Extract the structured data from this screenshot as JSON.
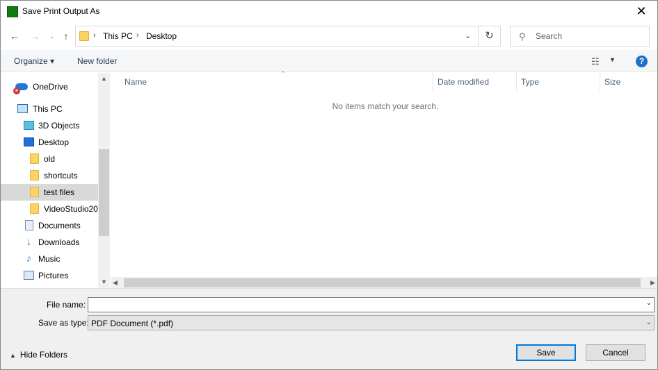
{
  "window": {
    "title": "Save Print Output As",
    "close_glyph": "✕"
  },
  "nav": {
    "back_glyph": "←",
    "forward_glyph": "→",
    "recent_glyph": "⌄",
    "up_glyph": "↑",
    "breadcrumbs": [
      "This PC",
      "Desktop"
    ],
    "separator": "›",
    "dropdown_glyph": "⌄",
    "refresh_glyph": "↻",
    "search_placeholder": "Search",
    "search_glyph": "⚲"
  },
  "toolbar": {
    "organize": "Organize ▾",
    "new_folder": "New folder",
    "view_glyph": "☷",
    "view_arrow": "▼",
    "help": "?"
  },
  "tree": {
    "items": [
      {
        "label": "OneDrive",
        "icon": "onedrive-icon"
      },
      {
        "label": "This PC",
        "icon": "this-pc-icon"
      },
      {
        "label": "3D Objects",
        "icon": "3d-objects-icon"
      },
      {
        "label": "Desktop",
        "icon": "desktop-icon"
      },
      {
        "label": "old",
        "icon": "folder-icon"
      },
      {
        "label": "shortcuts",
        "icon": "folder-icon"
      },
      {
        "label": "test files",
        "icon": "folder-icon",
        "selected": true
      },
      {
        "label": "VideoStudio20",
        "icon": "folder-icon"
      },
      {
        "label": "Documents",
        "icon": "documents-icon"
      },
      {
        "label": "Downloads",
        "icon": "downloads-icon"
      },
      {
        "label": "Music",
        "icon": "music-icon"
      },
      {
        "label": "Pictures",
        "icon": "pictures-icon"
      }
    ]
  },
  "files": {
    "columns": [
      "Name",
      "Date modified",
      "Type",
      "Size"
    ],
    "sort_glyph": "^",
    "empty_message": "No items match your search."
  },
  "scroll": {
    "up": "▲",
    "down": "▼",
    "left": "◀",
    "right": "▶"
  },
  "form": {
    "file_name_label": "File name:",
    "file_name_value": "",
    "save_type_label": "Save as type:",
    "save_type_value": "PDF Document (*.pdf)",
    "combo_glyph": "⌄"
  },
  "footer": {
    "hide_folders": "Hide Folders",
    "hide_caret": "▲",
    "save": "Save",
    "cancel": "Cancel"
  }
}
